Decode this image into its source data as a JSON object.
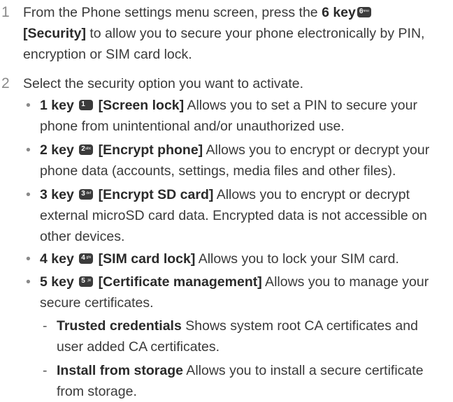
{
  "steps": [
    {
      "num": "1",
      "pre": "From the Phone settings menu screen, press the ",
      "key_bold": "6 key",
      "key_digit": "6",
      "key_letters": "mno",
      "label": "[Security]",
      "post": " to allow you to secure your phone electronically by PIN, encryption or SIM card lock."
    },
    {
      "num": "2",
      "text": "Select the security option you want to activate."
    }
  ],
  "options": [
    {
      "key": "1 key",
      "digit": "1",
      "letters": "",
      "label": "[Screen lock]",
      "desc": " Allows you to set a PIN to secure your phone from unintentional and/or unauthorized use."
    },
    {
      "key": "2 key",
      "digit": "2",
      "letters": "abc",
      "label": "[Encrypt phone]",
      "desc": " Allows you to encrypt or decrypt your phone data (accounts, settings, media files and other files)."
    },
    {
      "key": "3 key",
      "digit": "3",
      "letters": "def",
      "label": "[Encrypt SD card]",
      "desc": " Allows you to encrypt or decrypt external microSD card data. Encrypted data is not accessible on other devices."
    },
    {
      "key": "4 key",
      "digit": "4",
      "letters": "ghi",
      "label": "[SIM card lock]",
      "desc": " Allows you to lock your SIM card."
    },
    {
      "key": "5 key",
      "digit": "5",
      "letters": "jkl",
      "label": "[Certificate management]",
      "desc": " Allows you to manage your secure certificates."
    }
  ],
  "sub_options": [
    {
      "title": "Trusted credentials",
      "desc": " Shows system root CA certificates and user added CA certificates."
    },
    {
      "title": "Install from storage",
      "desc": " Allows you to install a secure certificate from storage."
    }
  ]
}
